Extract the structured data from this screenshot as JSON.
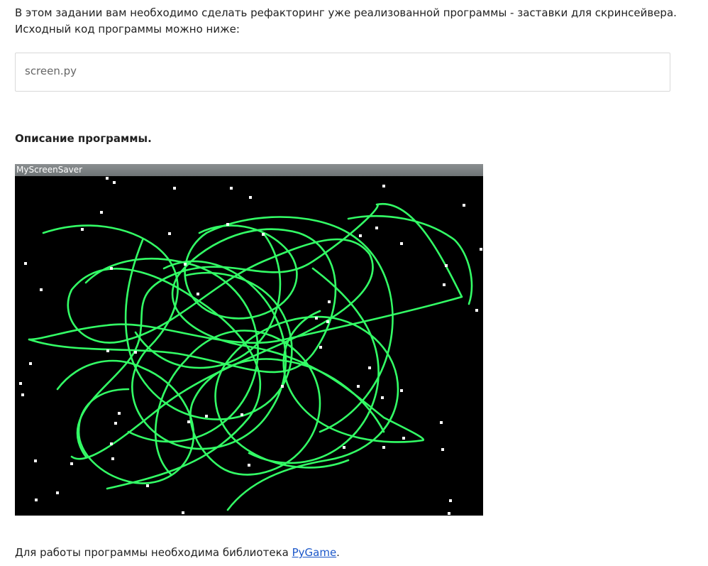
{
  "intro": {
    "line1": "В этом задании вам необходимо сделать рефакторинг уже реализованной программы - заставки для скринсейвера.",
    "line2": "Исходный код программы можно ниже:"
  },
  "attachment": {
    "filename": "screen.py"
  },
  "description_heading": "Описание программы.",
  "screensaver": {
    "window_title": "MyScreenSaver",
    "background_color": "#000000",
    "curve_color": "#33ff66",
    "point_color": "#ffffff"
  },
  "footer": {
    "text_before": "Для работы программы необходима библиотека ",
    "link_text": "PyGame",
    "text_after": "."
  }
}
